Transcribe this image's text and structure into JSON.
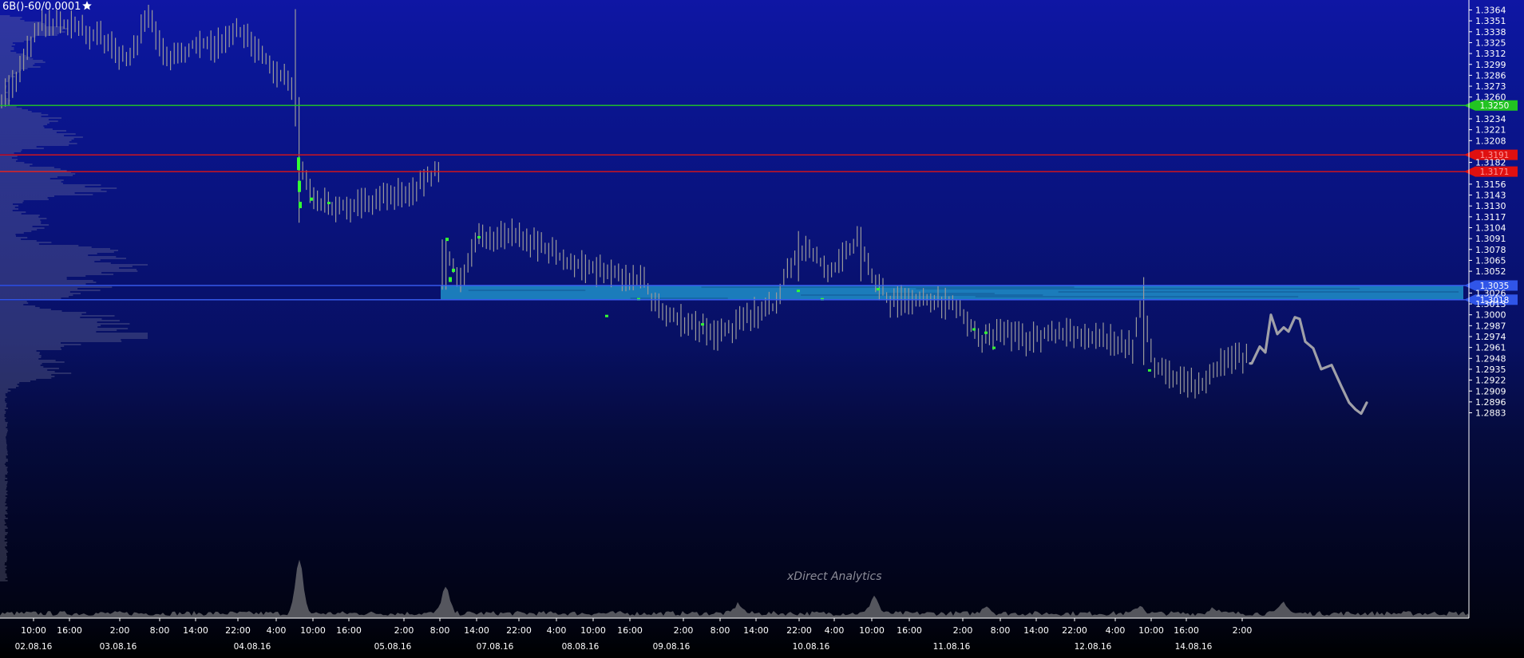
{
  "instrument_label": "6B()-60/0.0001",
  "star_icon": "star-icon",
  "watermark": "xDirect Analytics",
  "colors": {
    "candle": "#9a9a9a",
    "green_marker": "#33ff33",
    "support_line": "#22cc22",
    "resistance_line": "#e01515",
    "zone_line": "#3a5ff5",
    "zone_fill": "#1f8fc9",
    "tag_green": "#22c322",
    "tag_red": "#e01010",
    "tag_blue": "#3055e8",
    "axis_text": "#ffffff"
  },
  "chart_data": {
    "type": "candlestick",
    "price_axis": {
      "ticks": [
        "1.3364",
        "1.3351",
        "1.3338",
        "1.3325",
        "1.3312",
        "1.3299",
        "1.3286",
        "1.3273",
        "1.3260",
        "1.3234",
        "1.3221",
        "1.3208",
        "1.3182",
        "1.3156",
        "1.3143",
        "1.3130",
        "1.3117",
        "1.3104",
        "1.3091",
        "1.3078",
        "1.3065",
        "1.3052",
        "1.3026",
        "1.3013",
        "1.3000",
        "1.2987",
        "1.2974",
        "1.2961",
        "1.2948",
        "1.2935",
        "1.2922",
        "1.2909",
        "1.2896",
        "1.2883"
      ],
      "range": [
        1.2877,
        1.3372
      ]
    },
    "levels": [
      {
        "name": "support",
        "value": "1.3250",
        "color": "#22cc22",
        "tag_color": "#22c322",
        "tag_text_color": "#ffffff"
      },
      {
        "name": "resistance-1",
        "value": "1.3191",
        "color": "#e01515",
        "tag_color": "#e01010",
        "tag_text_color": "#ff9a9a"
      },
      {
        "name": "resistance-2",
        "value": "1.3171",
        "color": "#e01515",
        "tag_color": "#e01010",
        "tag_text_color": "#ff9a9a"
      },
      {
        "name": "zone-top",
        "value": "1.3035",
        "color": "#3a5ff5",
        "tag_color": "#3055e8",
        "tag_text_color": "#ffffff"
      },
      {
        "name": "zone-bottom",
        "value": "1.3018",
        "color": "#3a5ff5",
        "tag_color": "#3055e8",
        "tag_text_color": "#ffffff"
      }
    ],
    "zone": {
      "top": 1.3035,
      "bottom": 1.3018,
      "start": "05.08.16 8:00"
    },
    "time_ticks": [
      "10:00",
      "16:00",
      "2:00",
      "8:00",
      "14:00",
      "22:00",
      "4:00",
      "10:00",
      "16:00",
      "2:00",
      "8:00",
      "14:00",
      "22:00",
      "4:00",
      "10:00",
      "16:00",
      "2:00",
      "8:00",
      "14:00",
      "22:00",
      "4:00",
      "10:00",
      "16:00",
      "2:00",
      "8:00",
      "14:00",
      "22:00",
      "4:00",
      "10:00",
      "16:00",
      "2:00"
    ],
    "date_ticks": [
      "02.08.16",
      "03.08.16",
      "04.08.16",
      "05.08.16",
      "07.08.16",
      "08.08.16",
      "09.08.16",
      "10.08.16",
      "11.08.16",
      "12.08.16",
      "14.08.16"
    ],
    "projection": [
      [
        1.2942,
        1.2954
      ],
      [
        1.2962,
        1.299
      ],
      [
        1.2977,
        1.2983
      ],
      [
        1.2993,
        1.297
      ],
      [
        1.2962,
        1.2945
      ],
      [
        1.293,
        1.2904
      ],
      [
        1.2882,
        1.2893
      ]
    ]
  }
}
